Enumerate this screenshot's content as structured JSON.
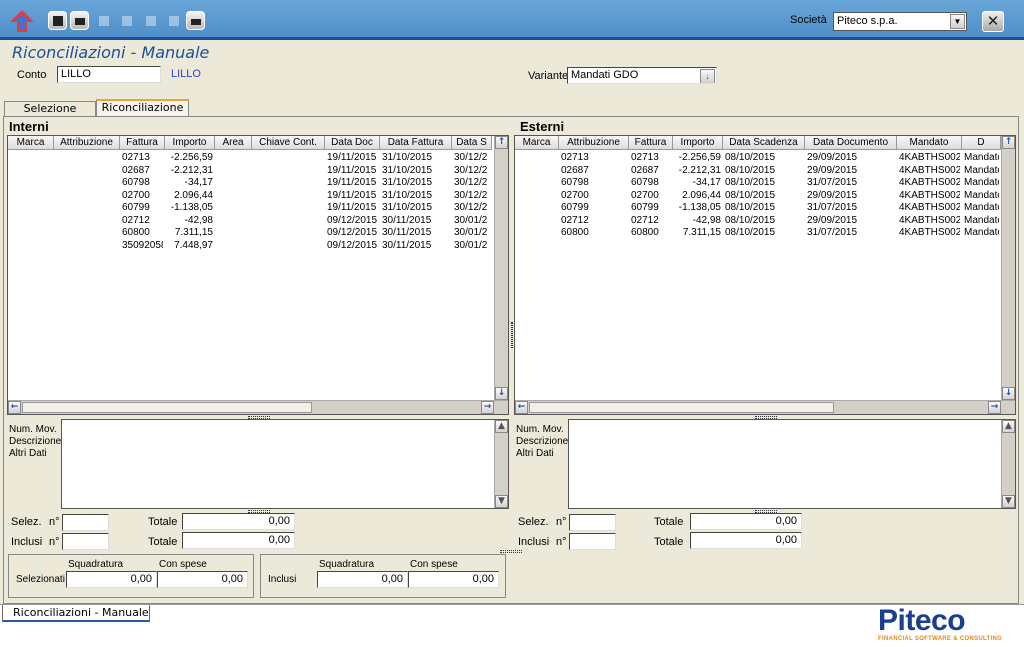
{
  "toolbar": {
    "societa_label": "Società",
    "societa_value": "Piteco s.p.a.",
    "close_label": "✕"
  },
  "page": {
    "title": "Riconciliazioni - Manuale"
  },
  "conto": {
    "label": "Conto",
    "value": "LILLO",
    "description": "LILLO"
  },
  "variante": {
    "label": "Variante",
    "value": "Mandati GDO"
  },
  "tabs": [
    {
      "label": "Selezione"
    },
    {
      "label": "Riconciliazione"
    }
  ],
  "interni": {
    "title": "Interni",
    "columns": [
      "Marca",
      "Attribuzione",
      "Fattura",
      "Importo",
      "Area",
      "Chiave Cont.",
      "Data Doc",
      "Data Fattura",
      "Data S"
    ],
    "rows": [
      [
        "",
        "",
        "02713",
        "-2.256,59",
        "",
        "",
        "19/11/2015",
        "31/10/2015",
        "30/12/2"
      ],
      [
        "",
        "",
        "02687",
        "-2.212,31",
        "",
        "",
        "19/11/2015",
        "31/10/2015",
        "30/12/2"
      ],
      [
        "",
        "",
        "60798",
        "-34,17",
        "",
        "",
        "19/11/2015",
        "31/10/2015",
        "30/12/2"
      ],
      [
        "",
        "",
        "02700",
        "2.096,44",
        "",
        "",
        "19/11/2015",
        "31/10/2015",
        "30/12/2"
      ],
      [
        "",
        "",
        "60799",
        "-1.138,05",
        "",
        "",
        "19/11/2015",
        "31/10/2015",
        "30/12/2"
      ],
      [
        "",
        "",
        "02712",
        "-42,98",
        "",
        "",
        "09/12/2015",
        "30/11/2015",
        "30/01/2"
      ],
      [
        "",
        "",
        "60800",
        "7.311,15",
        "",
        "",
        "09/12/2015",
        "30/11/2015",
        "30/01/2"
      ],
      [
        "",
        "",
        "35092058",
        "7.448,97",
        "",
        "",
        "09/12/2015",
        "30/11/2015",
        "30/01/2"
      ]
    ]
  },
  "esterni": {
    "title": "Esterni",
    "columns": [
      "Marca",
      "Attribuzione",
      "Fattura",
      "Importo",
      "Data Scadenza",
      "Data Documento",
      "Mandato",
      "D"
    ],
    "rows": [
      [
        "",
        "02713",
        "02713",
        "-2.256,59",
        "08/10/2015",
        "29/09/2015",
        "4KABTHS002",
        "Mandato"
      ],
      [
        "",
        "02687",
        "02687",
        "-2.212,31",
        "08/10/2015",
        "29/09/2015",
        "4KABTHS002",
        "Mandato"
      ],
      [
        "",
        "60798",
        "60798",
        "-34,17",
        "08/10/2015",
        "31/07/2015",
        "4KABTHS002",
        "Mandato"
      ],
      [
        "",
        "02700",
        "02700",
        "2.096,44",
        "08/10/2015",
        "29/09/2015",
        "4KABTHS002",
        "Mandato"
      ],
      [
        "",
        "60799",
        "60799",
        "-1.138,05",
        "08/10/2015",
        "31/07/2015",
        "4KABTHS002",
        "Mandato"
      ],
      [
        "",
        "02712",
        "02712",
        "-42,98",
        "08/10/2015",
        "29/09/2015",
        "4KABTHS002",
        "Mandato"
      ],
      [
        "",
        "60800",
        "60800",
        "7.311,15",
        "08/10/2015",
        "31/07/2015",
        "4KABTHS002",
        "Mandato"
      ]
    ]
  },
  "detail_labels": [
    "Num. Mov.",
    "Descrizione",
    "Altri Dati"
  ],
  "totals": {
    "selez_label": "Selez.",
    "inclusi_label": "Inclusi",
    "n_label": "n°",
    "totale_label": "Totale",
    "interni_selez_totale": "0,00",
    "interni_inclusi_totale": "0,00",
    "esterni_selez_totale": "0,00",
    "esterni_inclusi_totale": "0,00"
  },
  "summary": {
    "squadratura_label": "Squadratura",
    "con_spese_label": "Con spese",
    "selezionati_label": "Selezionati",
    "inclusi_label": "Inclusi",
    "selezionati_squadratura": "0,00",
    "selezionati_con_spese": "0,00",
    "inclusi_squadratura": "0,00",
    "inclusi_con_spese": "0,00"
  },
  "status": {
    "window_tab": "Riconciliazioni - Manuale"
  },
  "brand": {
    "name": "Piteco",
    "tagline": "FINANCIAL SOFTWARE & CONSULTING",
    "accent": "#1b3e8f"
  }
}
